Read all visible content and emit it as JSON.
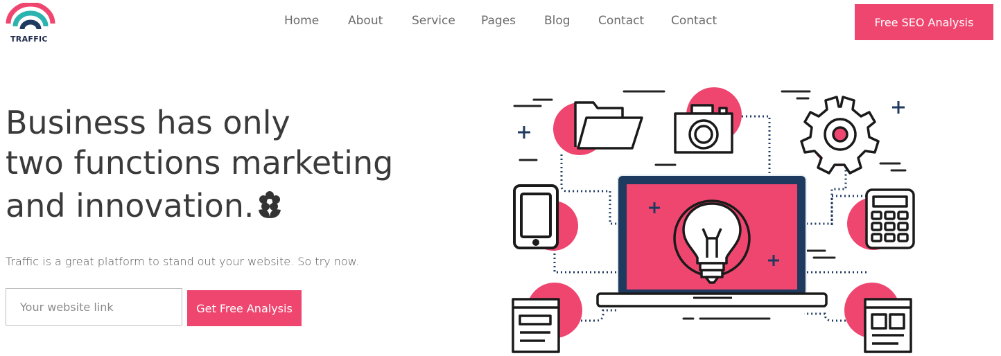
{
  "brand": {
    "name": "TRAFFIC",
    "logo": "traffic-rainbow-logo",
    "colors": {
      "pink": "#ef4670",
      "teal": "#2bb3b0",
      "navy": "#1e3a5f"
    }
  },
  "nav": {
    "items": [
      "Home",
      "About",
      "Service",
      "Pages",
      "Blog",
      "Contact",
      "Contact"
    ]
  },
  "header": {
    "cta_label": "Free SEO Analysis"
  },
  "hero": {
    "headline_line1": "Business has only",
    "headline_line2": "two functions marketing",
    "headline_line3": "and innovation.",
    "headline_icon": "flower-icon",
    "subtitle": "Traffic is a great platform to stand out your website. So try now.",
    "input_placeholder": "Your website link",
    "input_value": "",
    "cta_label": "Get Free Analysis"
  },
  "illustration": {
    "icons": [
      "folder-icon",
      "camera-icon",
      "gear-icon",
      "phone-icon",
      "laptop-icon",
      "lightbulb-icon",
      "calculator-icon",
      "browser-window-icon",
      "layout-window-icon"
    ],
    "colors": {
      "accent": "#ef4670",
      "stroke": "#1a1a1a",
      "dots": "#1e3a5f"
    }
  }
}
